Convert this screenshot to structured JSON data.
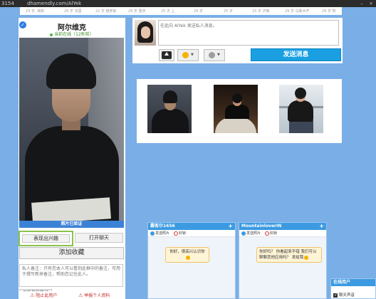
{
  "browser": {
    "tab_number": "3154",
    "url": "dhamendly.com/AlYek"
  },
  "top_strip": {
    "items": [
      "23 岁, 我和",
      "29 岁 法国",
      "22 岁 俄罗斯",
      "29 岁 重庆",
      "25 岁 上",
      "29 岁",
      "25 岁",
      "23 岁 济南",
      "29 岁 乌鲁木齐",
      "29 岁 阿"
    ]
  },
  "profile": {
    "name": "阿尔维克",
    "status": "当前在线（12秒前）",
    "photo_verified": "照片已验证",
    "interest_button": "表现出兴趣",
    "chat_button": "打开聊天",
    "favorite_button": "添加收藏",
    "note_placeholder": "私人备注：只有您本人可以看到此框中的备注，可用于撰写新来备注，帮助您记住此人。",
    "note_button": "更新您的笔记",
    "links": {
      "block": "阻止此用户",
      "report": "举报个人资料"
    }
  },
  "composer": {
    "placeholder": "在此向 AlYek 发送私人消息。",
    "send_label": "发送消息",
    "tools": [
      "photo-upload",
      "emoji",
      "gift"
    ]
  },
  "gallery": {
    "thumbs": [
      "photo-1",
      "photo-2",
      "photo-3"
    ]
  },
  "chats": [
    {
      "user": "霸客尔1656",
      "sub_left": "发送照片",
      "sub_right": "封锁",
      "message": "你好，很高兴认识你"
    },
    {
      "user": "MountainloverIN",
      "sub_left": "发送照片",
      "sub_right": "封锁",
      "message": "你好吗？ 你看起来不错 我们可以聊聊其他应用吗？ 发给我"
    }
  ],
  "online_panel": {
    "title": "在线用户",
    "sound_label": "聊天声音"
  },
  "colors": {
    "background": "#7aaee6",
    "accent": "#3b9ae1",
    "send": "#1aa0e2",
    "interest_border": "#8bc34a"
  }
}
